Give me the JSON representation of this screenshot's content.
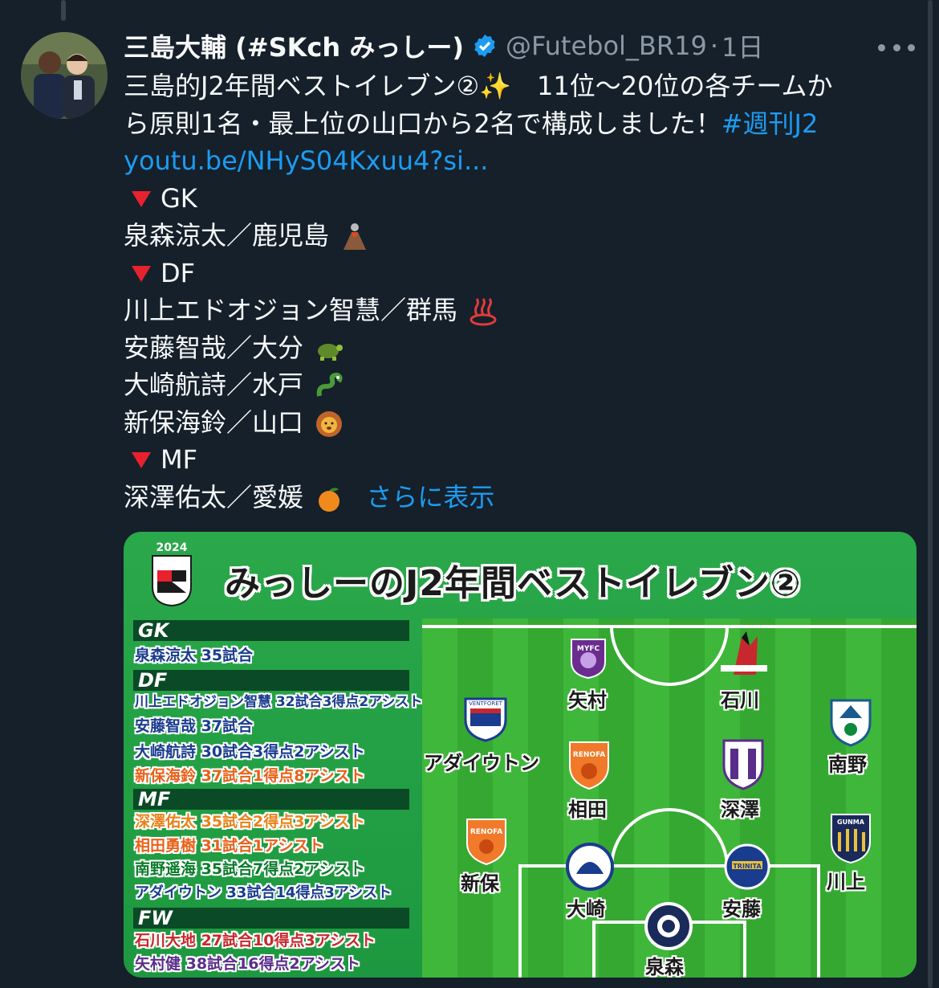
{
  "tweet": {
    "display_name": "三島大輔 (#SKch みっしー)",
    "handle": "@Futebol_BR19",
    "separator": "·",
    "time": "1日",
    "lines": {
      "l1": "三島的J2年間ベストイレブン②✨　11位〜20位の各チームか",
      "l2a": "ら原則1名・最上位の山口から2名で構成しました！",
      "l2b": "#週刊J2",
      "l3": "youtu.be/NHyS04Kxuu4?si...",
      "gk": "GK",
      "gk1": "泉森涼太／鹿児島",
      "df": "DF",
      "df1": "川上エドオジョン智慧／群馬",
      "df2": "安藤智哉／大分",
      "df3": "大崎航詩／水戸",
      "df4": "新保海鈴／山口",
      "mf": "MF",
      "mf1": "深澤佑太／愛媛",
      "more": "さらに表示"
    },
    "emoji_names": [
      "sparkles",
      "volcano-emoji",
      "hot-springs-emoji",
      "turtle-emoji",
      "dragon-emoji",
      "lion-emoji",
      "tangerine-emoji"
    ]
  },
  "card": {
    "year": "2024",
    "title": "みっしーのJ2年間ベストイレブン②",
    "sections": {
      "gk": "GK",
      "df": "DF",
      "mf": "MF",
      "fw": "FW"
    },
    "stats": {
      "gk1": "泉森涼太 35試合",
      "df1": "川上エドオジョン智慧 32試合3得点2アシスト",
      "df2": "安藤智哉 37試合",
      "df3": "大崎航詩 30試合3得点2アシスト",
      "df4": "新保海鈴 37試合1得点8アシスト",
      "mf1": "深澤佑太 35試合2得点3アシスト",
      "mf2": "相田勇樹 31試合1アシスト",
      "mf3": "南野遥海 35試合7得点2アシスト",
      "mf4": "アダイウトン 33試合14得点3アシスト",
      "fw1": "石川大地 27試合10得点3アシスト",
      "fw2": "矢村健 38試合16得点2アシスト"
    },
    "players": {
      "yamura": "矢村",
      "ishikawa": "石川",
      "adaiuton": "アダイウトン",
      "minamino": "南野",
      "aida": "相田",
      "fukazawa": "深澤",
      "shinbo": "新保",
      "kawakami": "川上",
      "osaki": "大崎",
      "ando": "安藤",
      "izumimori": "泉森"
    },
    "colors": {
      "navy": "#1a3c8f",
      "orange": "#e8621a",
      "red": "#c8282d",
      "green": "#0a7a2a",
      "purple": "#5a2d8a"
    }
  }
}
